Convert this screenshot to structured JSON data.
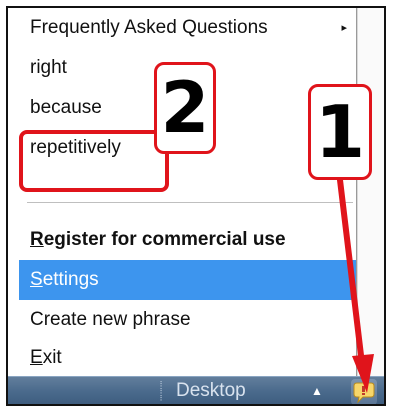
{
  "menu": {
    "items": [
      {
        "label": "Frequently Asked Questions",
        "style": "normal",
        "has_submenu": true
      },
      {
        "label": "right",
        "style": "normal",
        "has_submenu": false
      },
      {
        "label": "because",
        "style": "normal",
        "has_submenu": false
      },
      {
        "label": "repetitively",
        "style": "normal",
        "has_submenu": false
      },
      {
        "label": "Register for commercial use",
        "style": "bold",
        "has_submenu": false
      },
      {
        "label": "Settings",
        "style": "highlighted",
        "has_submenu": false
      },
      {
        "label": "Create new phrase",
        "style": "normal",
        "has_submenu": false
      },
      {
        "label": "Exit",
        "style": "normal",
        "has_submenu": false
      }
    ],
    "submenu_arrow": "▸"
  },
  "taskbar": {
    "desktop_label": "Desktop",
    "show_hidden_icon": "up-triangle-icon",
    "show_hidden_glyph": "▲",
    "tray_icon": "phrase-tool-tray-icon",
    "grip_glyph": "⁝⁝"
  },
  "annotations": {
    "callout_1": "1",
    "callout_2": "2",
    "color": "#e0141b"
  },
  "colors": {
    "menu_highlight": "#3d95ee",
    "taskbar": "#4a6a8c",
    "annotation_red": "#e0141b"
  }
}
